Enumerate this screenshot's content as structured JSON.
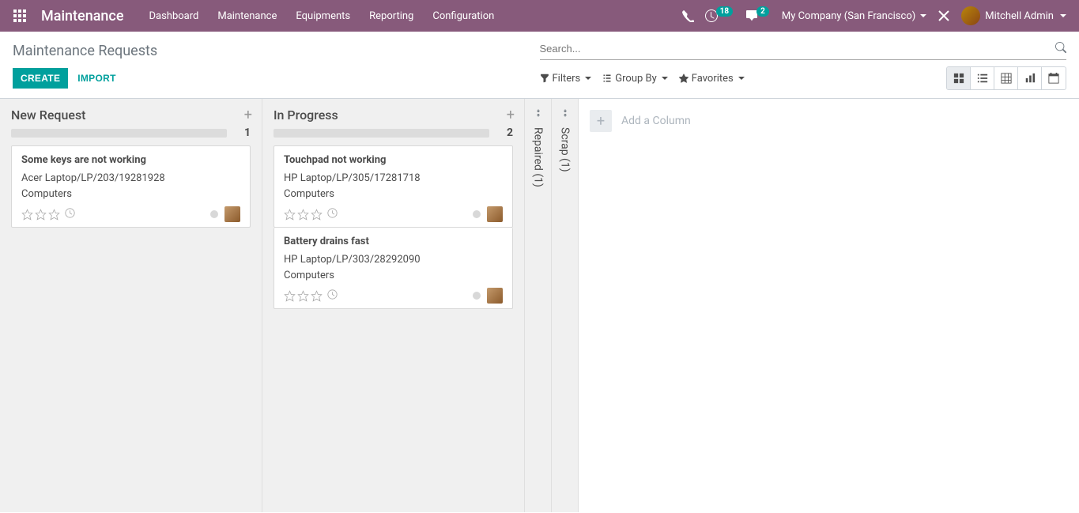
{
  "navbar": {
    "brand": "Maintenance",
    "menu": [
      "Dashboard",
      "Maintenance",
      "Equipments",
      "Reporting",
      "Configuration"
    ],
    "activities_badge": "18",
    "messages_badge": "2",
    "company": "My Company (San Francisco)",
    "user": "Mitchell Admin"
  },
  "control_panel": {
    "title": "Maintenance Requests",
    "search_placeholder": "Search...",
    "create_label": "CREATE",
    "import_label": "IMPORT",
    "filters_label": "Filters",
    "groupby_label": "Group By",
    "favorites_label": "Favorites"
  },
  "kanban": {
    "columns": [
      {
        "title": "New Request",
        "count": "1",
        "cards": [
          {
            "title": "Some keys are not working",
            "equipment": "Acer Laptop/LP/203/19281928",
            "category": "Computers"
          }
        ]
      },
      {
        "title": "In Progress",
        "count": "2",
        "cards": [
          {
            "title": "Touchpad not working",
            "equipment": "HP Laptop/LP/305/17281718",
            "category": "Computers"
          },
          {
            "title": "Battery drains fast",
            "equipment": "HP Laptop/LP/303/28292090",
            "category": "Computers"
          }
        ]
      }
    ],
    "folded": [
      {
        "label": "Repaired (1)"
      },
      {
        "label": "Scrap (1)"
      }
    ],
    "add_column_label": "Add a Column"
  }
}
